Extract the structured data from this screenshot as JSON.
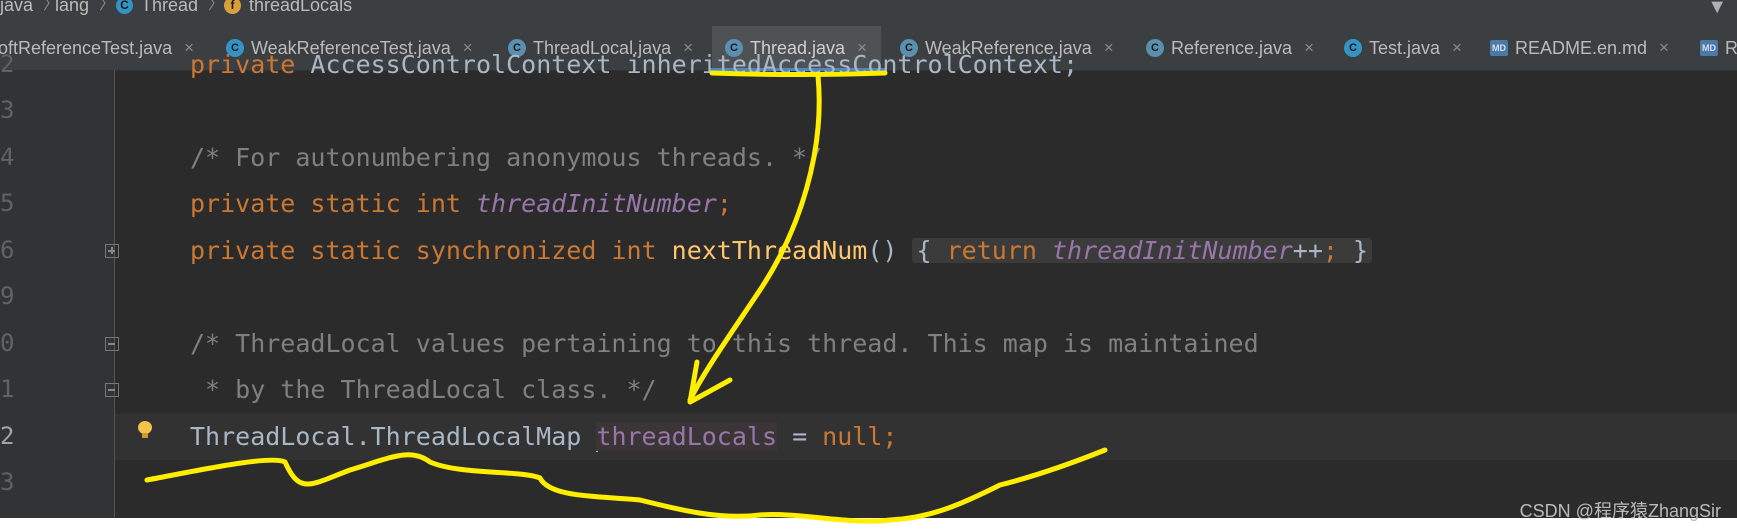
{
  "breadcrumb": [
    "java",
    "lang",
    "Thread",
    "threadLocals"
  ],
  "tabs": [
    {
      "label": "oftReferenceTest.java"
    },
    {
      "label": "WeakReferenceTest.java"
    },
    {
      "label": "ThreadLocal.java"
    },
    {
      "label": "Thread.java",
      "active": true
    },
    {
      "label": "WeakReference.java"
    },
    {
      "label": "Reference.java"
    },
    {
      "label": "Test.java"
    },
    {
      "label": "README.en.md"
    },
    {
      "label": "R"
    }
  ],
  "icons": {
    "class_icon": "C",
    "field_icon": "f",
    "md_icon": "MD",
    "close_icon": "×"
  },
  "line_numbers": [
    "2",
    "3",
    "4",
    "5",
    "6",
    "9",
    "0",
    "1",
    "2",
    "3"
  ],
  "code": {
    "line_2_keyword": "private ",
    "line_2_rest": "AccessControlContext inheritedAccessControlContext;",
    "line_4_comment": "/* For autonumbering anonymous threads. */",
    "line_5_kw": "private static int ",
    "line_5_field": "threadInitNumber",
    "line_5_end": ";",
    "line_6_kw": "private static synchronized int ",
    "line_6_fn": "nextThreadNum",
    "line_6_paren": "()",
    "line_6_brace_open": "{",
    "line_6_return": "return ",
    "line_6_field": "threadInitNumber",
    "line_6_inc": "++",
    "line_6_semi": ";",
    "line_6_brace_close": "}",
    "line_10_comment": "/* ThreadLocal values pertaining to this thread. This map is maintained",
    "line_11_comment": " * by the ThreadLocal class. */",
    "line_12_type": "ThreadLocal.ThreadLocalMap ",
    "line_12_field": "threadLocals",
    "line_12_assign": " = ",
    "line_12_null": "null",
    "line_12_semi": ";"
  },
  "watermark": "CSDN @程序猿ZhangSir",
  "colors": {
    "editor_bg": "#2b2b2b",
    "keyword": "#cc7832",
    "comment": "#808080",
    "static_field": "#9876aa",
    "function": "#ffc66d",
    "annotation_pen": "#ffee00"
  }
}
